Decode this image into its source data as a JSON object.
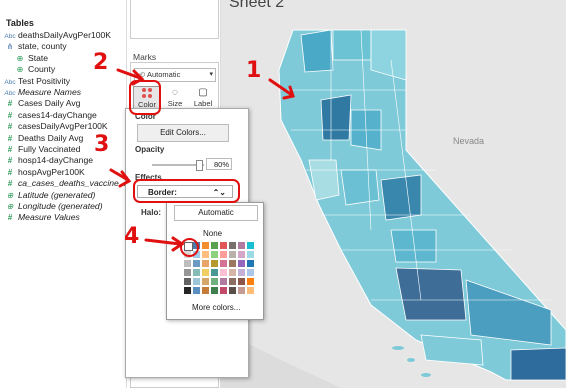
{
  "data_pane": {
    "title": "Tables",
    "fields": [
      {
        "icon": "abc",
        "label": "deathsDailyAvgPer100K",
        "italic": false
      },
      {
        "icon": "hier",
        "label": "state, county",
        "italic": false
      },
      {
        "icon": "globe",
        "label": "State",
        "italic": false
      },
      {
        "icon": "globe",
        "label": "County",
        "italic": false
      },
      {
        "icon": "abc",
        "label": "Test Positivity",
        "italic": false
      },
      {
        "icon": "abc",
        "label": "Measure Names",
        "italic": true
      },
      {
        "icon": "hash",
        "label": "Cases Daily Avg",
        "italic": false
      },
      {
        "icon": "hash",
        "label": "cases14-dayChange",
        "italic": false
      },
      {
        "icon": "hash",
        "label": "casesDailyAvgPer100K",
        "italic": false
      },
      {
        "icon": "hash",
        "label": "Deaths Daily Avg",
        "italic": false
      },
      {
        "icon": "hash",
        "label": "Fully Vaccinated",
        "italic": false
      },
      {
        "icon": "hash",
        "label": "hosp14-dayChange",
        "italic": false
      },
      {
        "icon": "hash",
        "label": "hospAvgPer100K",
        "italic": false
      },
      {
        "icon": "hash",
        "label": "ca_cases_deaths_vaccine...",
        "italic": true
      },
      {
        "icon": "globe",
        "label": "Latitude (generated)",
        "italic": true
      },
      {
        "icon": "globe",
        "label": "Longitude (generated)",
        "italic": true
      },
      {
        "icon": "hash",
        "label": "Measure Values",
        "italic": true
      }
    ]
  },
  "marks": {
    "title": "Marks",
    "mark_type": "Automatic",
    "buttons": {
      "color": "Color",
      "size": "Size",
      "label": "Label"
    }
  },
  "view": {
    "sheet_title": "Sheet 2",
    "map_label": "Nevada"
  },
  "color_popup": {
    "color_heading": "Color",
    "edit_colors": "Edit Colors...",
    "opacity_heading": "Opacity",
    "opacity_value": "80%",
    "effects_heading": "Effects",
    "border_label": "Border:",
    "halo_label": "Halo:"
  },
  "halo_popup": {
    "automatic": "Automatic",
    "none": "None",
    "more_colors": "More colors..."
  },
  "annotations": {
    "n1": "1",
    "n2": "2",
    "n3": "3",
    "n4": "4"
  },
  "colors": {
    "annotation_red": "#e01010",
    "map_bg": "#e9e9e9",
    "county_light": "#a9dde4",
    "county_mid": "#5bb8cd",
    "county_dark": "#3c7fa3"
  }
}
